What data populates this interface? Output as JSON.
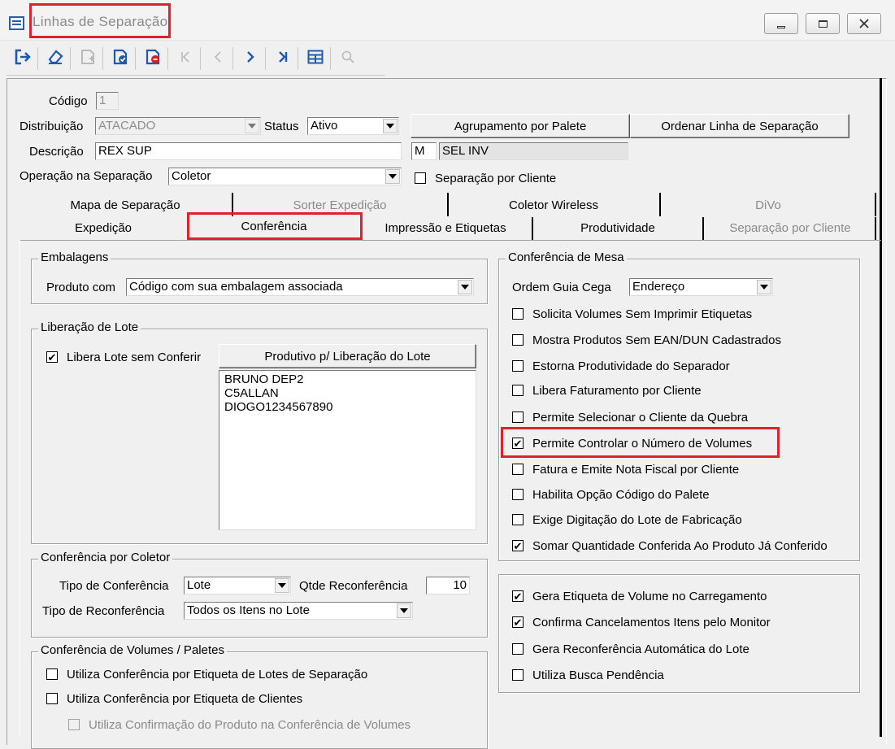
{
  "window": {
    "title": "Linhas de Separação",
    "controls": [
      "minimize-icon",
      "restore-icon",
      "close-icon"
    ]
  },
  "toolbar": {
    "buttons": [
      {
        "icon": "exit-icon",
        "enabled": true
      },
      {
        "icon": "eraser-icon",
        "enabled": true
      },
      {
        "icon": "new-record-icon",
        "enabled": false
      },
      {
        "icon": "save-record-icon",
        "enabled": true
      },
      {
        "icon": "delete-record-icon",
        "enabled": true
      },
      {
        "icon": "first-record-icon",
        "enabled": false
      },
      {
        "icon": "prev-record-icon",
        "enabled": false
      },
      {
        "icon": "next-record-icon",
        "enabled": true
      },
      {
        "icon": "last-record-icon",
        "enabled": true
      },
      {
        "icon": "grid-icon",
        "enabled": true
      },
      {
        "icon": "search-icon",
        "enabled": false
      }
    ]
  },
  "header": {
    "codigo_label": "Código",
    "codigo_value": "1",
    "distribuicao_label": "Distribuição",
    "distribuicao_value": "ATACADO",
    "status_label": "Status",
    "status_value": "Ativo",
    "descricao_label": "Descrição",
    "descricao_value": "REX SUP",
    "operacao_label": "Operação na Separação",
    "operacao_value": "Coletor",
    "code_m": "M",
    "code_sel": "SEL INV",
    "agrupamento_button": "Agrupamento por Palete",
    "ordenar_button": "Ordenar Linha de Separação",
    "separacao_cliente_check": "Separação por Cliente",
    "separacao_cliente_checked": false
  },
  "tabs": {
    "row1": [
      {
        "label": "Mapa de Separação",
        "enabled": true
      },
      {
        "label": "Sorter Expedição",
        "enabled": false
      },
      {
        "label": "Coletor Wireless",
        "enabled": true
      },
      {
        "label": "DiVo",
        "enabled": false
      }
    ],
    "row2": [
      {
        "label": "Expedição",
        "enabled": true
      },
      {
        "label": "Conferência",
        "enabled": true,
        "active": true
      },
      {
        "label": "Impressão e Etiquetas",
        "enabled": true
      },
      {
        "label": "Produtividade",
        "enabled": true
      },
      {
        "label": "Separação por Cliente",
        "enabled": false
      }
    ]
  },
  "embalagens": {
    "title": "Embalagens",
    "produto_label": "Produto com",
    "produto_value": "Código com sua embalagem associada"
  },
  "liberacao": {
    "title": "Liberação de Lote",
    "check_label": "Libera Lote sem Conferir",
    "checked": true,
    "button_label": "Produtivo p/ Liberação do Lote",
    "list": [
      "BRUNO DEP2",
      "C5ALLAN",
      "DIOGO1234567890"
    ]
  },
  "coletor": {
    "title": "Conferência por Coletor",
    "tipo_label": "Tipo de Conferência",
    "tipo_value": "Lote",
    "qtde_label": "Qtde Reconferência",
    "qtde_value": "10",
    "tipo_reconf_label": "Tipo de Reconferência",
    "tipo_reconf_value": "Todos os Itens no Lote"
  },
  "volumes": {
    "title": "Conferência de Volumes / Paletes",
    "items": [
      {
        "label": "Utiliza Conferência por Etiqueta de Lotes de Separação",
        "checked": false,
        "enabled": true
      },
      {
        "label": "Utiliza Conferência por Etiqueta de Clientes",
        "checked": false,
        "enabled": true
      },
      {
        "label": "Utiliza Confirmação do Produto na Conferência de Volumes",
        "checked": false,
        "enabled": false
      }
    ]
  },
  "mesa": {
    "title": "Conferência de Mesa",
    "ordem_label": "Ordem Guia Cega",
    "ordem_value": "Endereço",
    "items": [
      {
        "label": "Solicita Volumes Sem Imprimir Etiquetas",
        "checked": false
      },
      {
        "label": "Mostra Produtos Sem EAN/DUN Cadastrados",
        "checked": false
      },
      {
        "label": "Estorna Produtividade do Separador",
        "checked": false
      },
      {
        "label": "Libera Faturamento por Cliente",
        "checked": false
      },
      {
        "label": "Permite Selecionar o Cliente da Quebra",
        "checked": false
      },
      {
        "label": "Permite Controlar o Número de Volumes",
        "checked": true
      },
      {
        "label": "Fatura e Emite Nota Fiscal por Cliente",
        "checked": false
      },
      {
        "label": "Habilita Opção Código do Palete",
        "checked": false
      },
      {
        "label": "Exige Digitação do Lote de Fabricação",
        "checked": false
      },
      {
        "label": "Somar Quantidade Conferida Ao Produto Já Conferido",
        "checked": true
      }
    ]
  },
  "outros": {
    "items": [
      {
        "label": "Gera Etiqueta de Volume no Carregamento",
        "checked": true
      },
      {
        "label": "Confirma Cancelamentos Itens pelo Monitor",
        "checked": true
      },
      {
        "label": "Gera Reconferência Automática do Lote",
        "checked": false
      },
      {
        "label": "Utiliza Busca Pendência",
        "checked": false
      }
    ]
  },
  "colors": {
    "highlight_red": "#e0212c",
    "toolbar_blue": "#1e5bb0",
    "delete_red": "#d42020"
  }
}
